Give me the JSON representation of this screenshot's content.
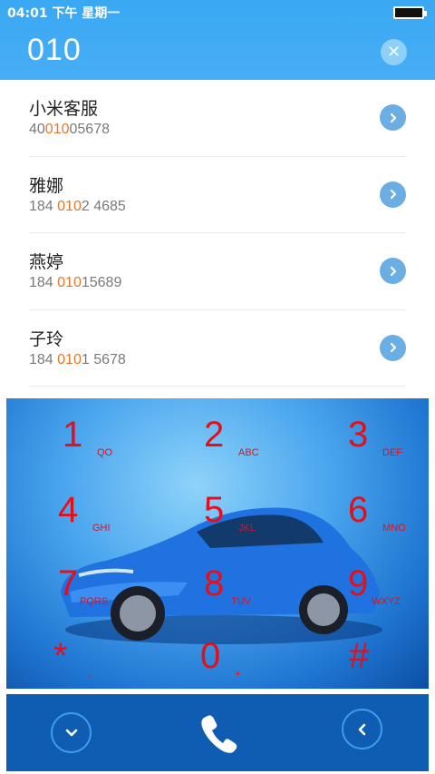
{
  "status_bar": {
    "time": "04:01 下午 星期一"
  },
  "search": {
    "value": "010",
    "clear_icon": "close-icon"
  },
  "contacts": [
    {
      "name": "小米客服",
      "num_pre": "40",
      "num_hl": "010",
      "num_post": "05678"
    },
    {
      "name": "雅娜",
      "num_pre": "184 ",
      "num_hl": "010",
      "num_post": "2 4685"
    },
    {
      "name": "燕婷",
      "num_pre": "184 ",
      "num_hl": "010",
      "num_post": "15689"
    },
    {
      "name": "子玲",
      "num_pre": "184 ",
      "num_hl": "010",
      "num_post": "1 5678"
    }
  ],
  "dialpad": {
    "keys": [
      {
        "digit": "1",
        "letters": "QO"
      },
      {
        "digit": "2",
        "letters": "ABC"
      },
      {
        "digit": "3",
        "letters": "DEF"
      },
      {
        "digit": "4",
        "letters": "GHI"
      },
      {
        "digit": "5",
        "letters": "JKL"
      },
      {
        "digit": "6",
        "letters": "MNO"
      },
      {
        "digit": "7",
        "letters": "PQRS"
      },
      {
        "digit": "8",
        "letters": "TUV"
      },
      {
        "digit": "9",
        "letters": "WXYZ"
      },
      {
        "digit": "*",
        "letters": ","
      },
      {
        "digit": "0",
        "letters": "+"
      },
      {
        "digit": "#",
        "letters": ""
      }
    ]
  },
  "colors": {
    "header": "#3aa8f3",
    "highlight": "#e8762b",
    "digit": "#e3101c",
    "bar": "#0f5cb3"
  },
  "actions": {
    "collapse_icon": "chevron-down-icon",
    "call_icon": "phone-icon",
    "backspace_icon": "chevron-left-icon"
  }
}
